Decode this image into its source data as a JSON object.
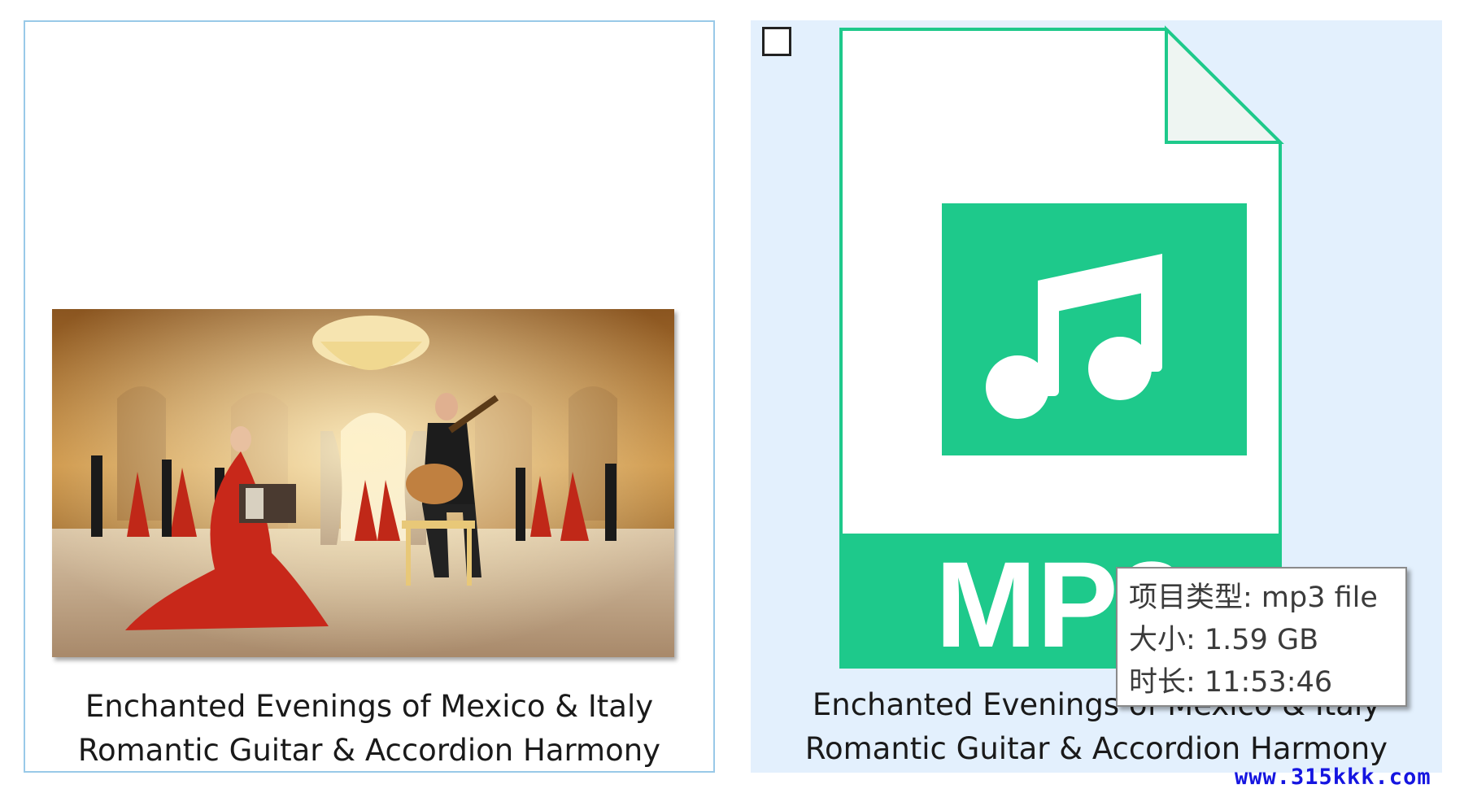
{
  "items": [
    {
      "caption_line1": "Enchanted Evenings of Mexico & Italy",
      "caption_line2": "Romantic Guitar & Accordion Harmony"
    },
    {
      "caption_line1": "Enchanted Evenings of Mexico & Italy",
      "caption_line2": "Romantic Guitar & Accordion Harmony",
      "icon_label": "MP3",
      "icon": "music-note-icon",
      "selected": false
    }
  ],
  "tooltip": {
    "type_label": "项目类型: mp3 file",
    "size_label": "大小: 1.59 GB",
    "duration_label": "时长: 11:53:46"
  },
  "watermark": "www.315kkk.com",
  "colors": {
    "icon_green": "#1ec98b",
    "hover_background": "#e3f0fd",
    "selection_border": "#99c9e8",
    "watermark_blue": "#1515e0"
  }
}
